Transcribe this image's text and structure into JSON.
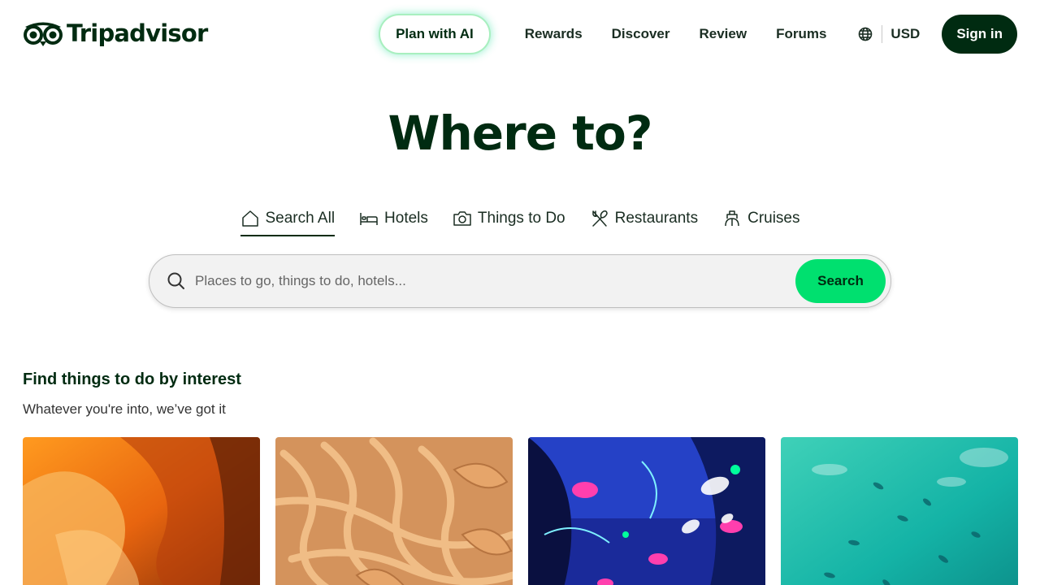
{
  "header": {
    "logo_text": "Tripadvisor",
    "nav": {
      "plan_ai": "Plan with AI",
      "rewards": "Rewards",
      "discover": "Discover",
      "review": "Review",
      "forums": "Forums",
      "currency": "USD",
      "sign_in": "Sign in"
    }
  },
  "hero": {
    "title": "Where to?",
    "tabs": [
      {
        "label": "Search All",
        "icon": "home-icon",
        "active": true
      },
      {
        "label": "Hotels",
        "icon": "bed-icon",
        "active": false
      },
      {
        "label": "Things to Do",
        "icon": "camera-icon",
        "active": false
      },
      {
        "label": "Restaurants",
        "icon": "utensils-icon",
        "active": false
      },
      {
        "label": "Cruises",
        "icon": "ship-icon",
        "active": false
      }
    ],
    "search": {
      "placeholder": "Places to go, things to do, hotels...",
      "value": "",
      "button": "Search"
    }
  },
  "interest": {
    "title": "Find things to do by interest",
    "subtitle": "Whatever you're into, we’ve got it",
    "cards": [
      {
        "image": "canyon-photo"
      },
      {
        "image": "pasta-photo"
      },
      {
        "image": "neon-art-photo"
      },
      {
        "image": "turquoise-water-photo"
      }
    ]
  },
  "colors": {
    "brand_dark": "#002b11",
    "search_green": "#00e06f",
    "ai_glow": "#34e0a1"
  }
}
